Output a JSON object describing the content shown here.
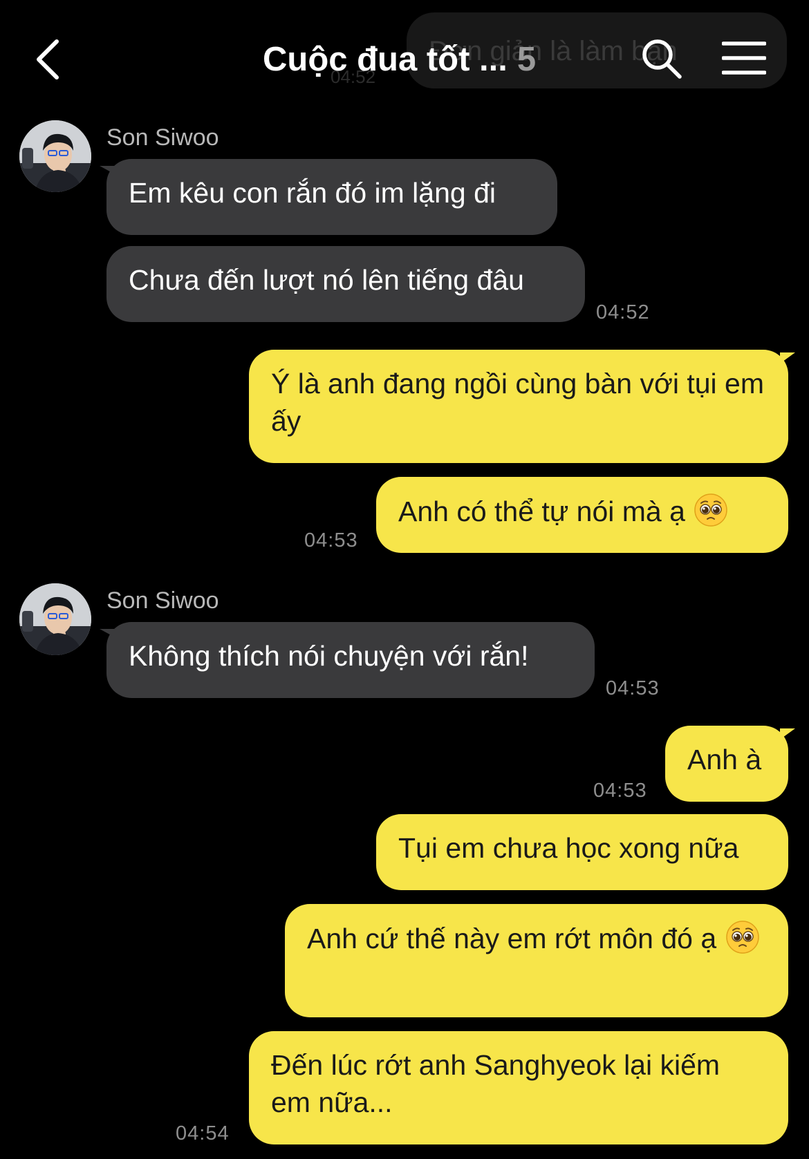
{
  "header": {
    "title": "Cuộc đua tốt ...",
    "member_count": "5",
    "ghost_message": "Đơn giản là làm bạn",
    "ghost_time": "04:52"
  },
  "colors": {
    "background": "#000000",
    "incoming_bubble": "#3a3a3c",
    "outgoing_bubble": "#f7e54a",
    "timestamp": "#8e8e8e",
    "sender_name": "#b8b8b8"
  },
  "icons": {
    "back": "chevron-left-icon",
    "search": "search-icon",
    "menu": "hamburger-menu-icon",
    "emoji": "pleading-face-emoji"
  },
  "messages": [
    {
      "sender": "Son Siwoo",
      "direction": "incoming",
      "text": "Em kêu con rắn đó im lặng đi"
    },
    {
      "direction": "incoming",
      "text": "Chưa đến lượt nó lên tiếng đâu",
      "time": "04:52"
    },
    {
      "direction": "outgoing",
      "text": "Ý là anh đang ngồi cùng bàn với tụi em ấy"
    },
    {
      "direction": "outgoing",
      "text": "Anh có thể tự nói mà ạ",
      "emoji": "pleading-face-emoji",
      "time": "04:53"
    },
    {
      "sender": "Son Siwoo",
      "direction": "incoming",
      "text": "Không thích nói chuyện với rắn!",
      "time": "04:53"
    },
    {
      "direction": "outgoing",
      "text": "Anh à",
      "time": "04:53"
    },
    {
      "direction": "outgoing",
      "text": "Tụi em chưa học xong nữa"
    },
    {
      "direction": "outgoing",
      "text": "Anh cứ thế này em rớt môn đó ạ",
      "emoji": "pleading-face-emoji"
    },
    {
      "direction": "outgoing",
      "text": "Đến lúc rớt anh Sanghyeok lại kiếm em nữa...",
      "time": "04:54"
    }
  ]
}
